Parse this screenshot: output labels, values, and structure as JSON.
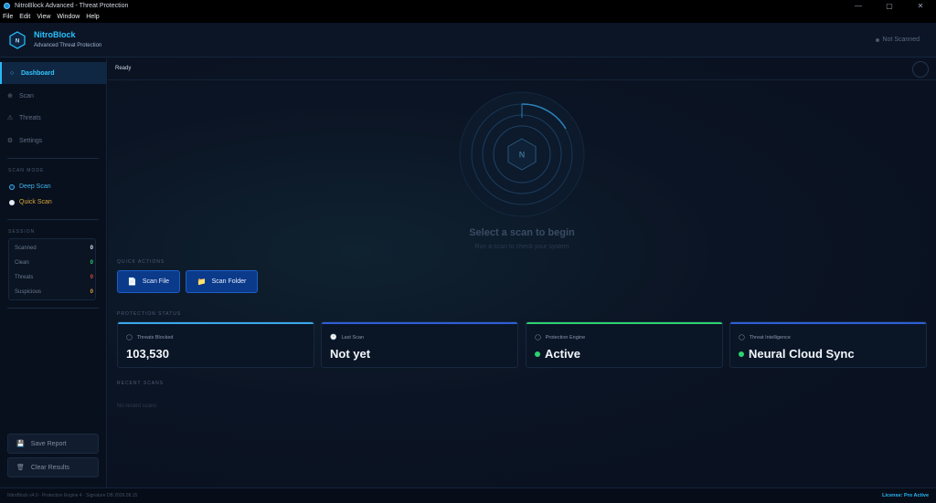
{
  "window": {
    "title": "NitroBlock Advanced - Threat Protection",
    "menu": [
      "File",
      "Edit",
      "View",
      "Window",
      "Help"
    ],
    "controls": [
      "—",
      "▢",
      "✕"
    ]
  },
  "header": {
    "brand": "NitroBlock",
    "subtitle": "Advanced Threat Protection",
    "scan_state": "Not Scanned",
    "logo_letter": "N"
  },
  "sidebar": {
    "nav": [
      {
        "label": "Dashboard",
        "icon": "dashboard-icon",
        "active": true
      },
      {
        "label": "Scan",
        "icon": "scan-icon",
        "active": false
      },
      {
        "label": "Threats",
        "icon": "warning-icon",
        "active": false
      },
      {
        "label": "Settings",
        "icon": "gear-icon",
        "active": false
      }
    ],
    "scan_mode_label": "SCAN MODE",
    "scan_modes": [
      {
        "label": "Deep Scan",
        "selected": true
      },
      {
        "label": "Quick Scan",
        "selected": false
      }
    ],
    "session_label": "SESSION",
    "stats": [
      {
        "label": "Scanned",
        "value": "0",
        "color": "#e6edf7"
      },
      {
        "label": "Clean",
        "value": "0",
        "color": "#2dd36f"
      },
      {
        "label": "Threats",
        "value": "0",
        "color": "#e0483f"
      },
      {
        "label": "Suspicious",
        "value": "0",
        "color": "#e8a23a"
      }
    ],
    "buttons": [
      {
        "label": "Save Report",
        "icon": "save-icon"
      },
      {
        "label": "Clear Results",
        "icon": "trash-icon"
      }
    ]
  },
  "main": {
    "status": "Ready",
    "radar_letter": "N",
    "prompt_title": "Select a scan to begin",
    "prompt_sub": "Run a scan to check your system",
    "quick_actions_label": "QUICK ACTIONS",
    "quick_actions": [
      {
        "label": "Scan File",
        "icon": "file-icon"
      },
      {
        "label": "Scan Folder",
        "icon": "folder-icon"
      }
    ],
    "protection_label": "PROTECTION STATUS",
    "cards": [
      {
        "label": "Threats Blocked",
        "value": "103,530",
        "icon": "shield-icon",
        "accent": "#3aa7e8",
        "dot": false
      },
      {
        "label": "Last Scan",
        "value": "Not yet",
        "icon": "clock-icon",
        "accent": "#2f5fd6",
        "dot": false
      },
      {
        "label": "Protection Engine",
        "value": "Active",
        "icon": "engine-icon",
        "accent": "#2dd36f",
        "dot": true
      },
      {
        "label": "Threat Intelligence",
        "value": "Neural Cloud Sync",
        "icon": "cloud-icon",
        "accent": "#2f5fd6",
        "dot": true
      }
    ],
    "recent_label": "RECENT SCANS",
    "recent_empty": "No recent scans"
  },
  "footer": {
    "left": "NitroBlock v4.0 · Protection Engine 4 · Signature DB 2026.08.15",
    "right": "License: Pro Active"
  }
}
